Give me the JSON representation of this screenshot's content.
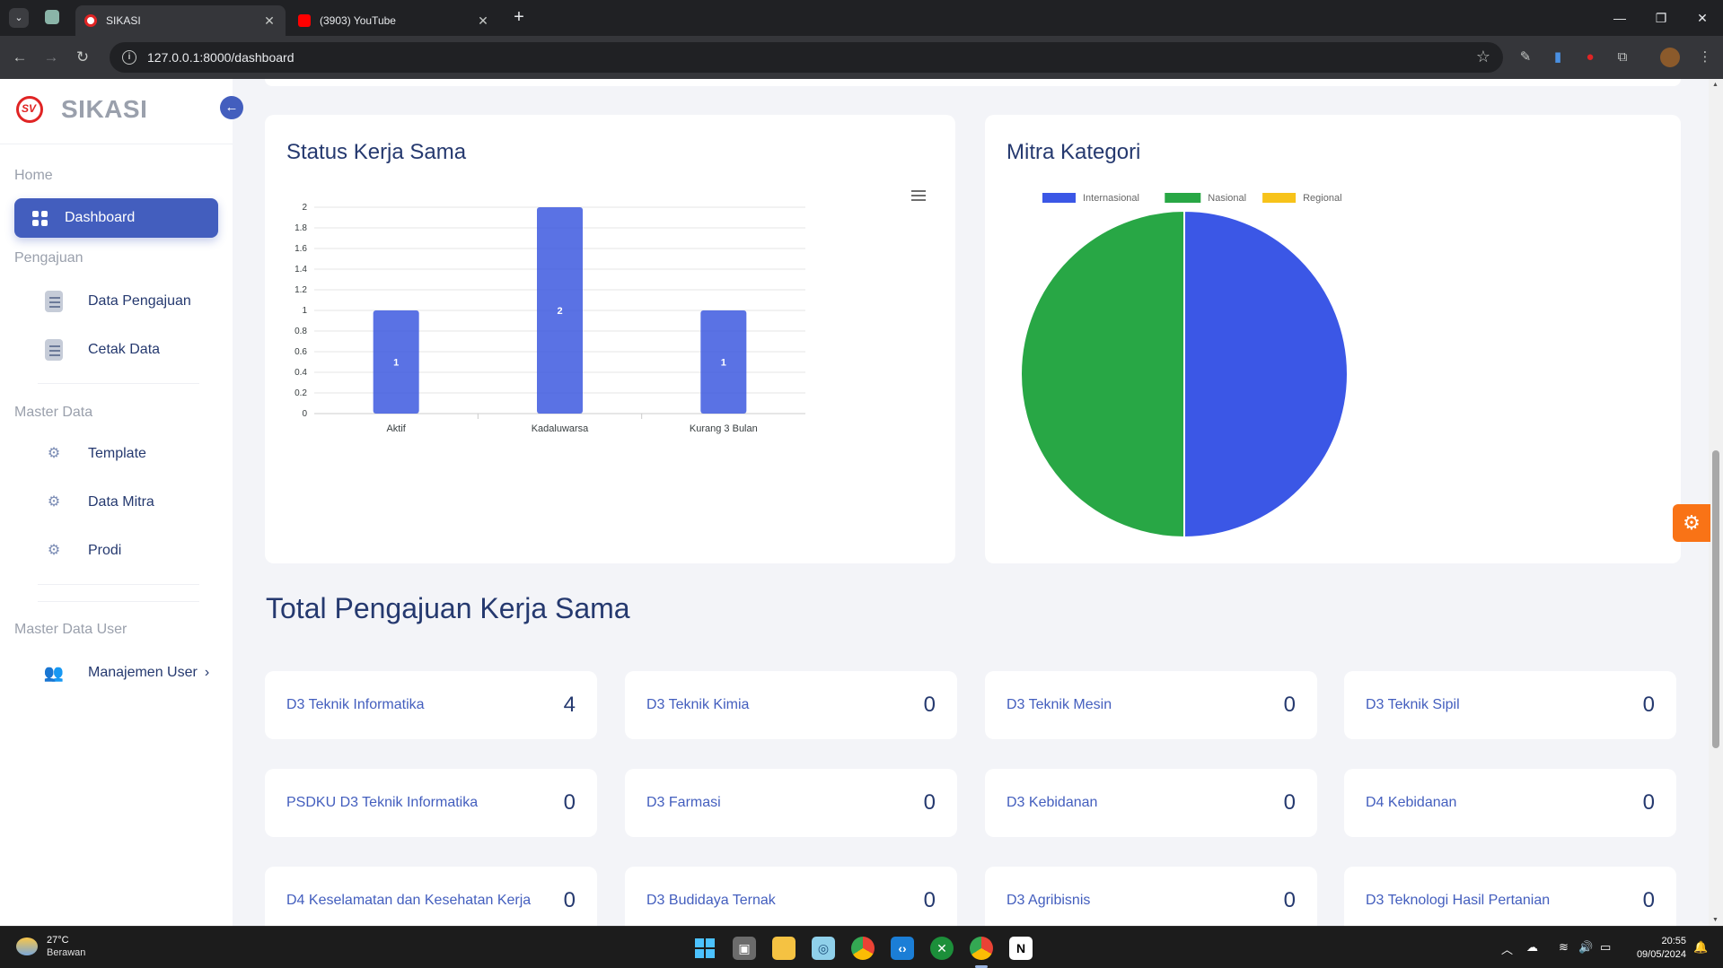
{
  "browser": {
    "tabs": [
      {
        "title": "SIKASI",
        "active": true
      },
      {
        "title": "(3903) YouTube",
        "active": false
      }
    ],
    "url": "127.0.0.1:8000/dashboard"
  },
  "sidebar": {
    "brand": "SIKASI",
    "sections": [
      {
        "title": "Home",
        "items": [
          {
            "label": "Dashboard",
            "icon": "grid-icon",
            "active": true
          }
        ]
      },
      {
        "title": "Pengajuan",
        "items": [
          {
            "label": "Data Pengajuan",
            "icon": "document-icon"
          },
          {
            "label": "Cetak Data",
            "icon": "download-icon"
          }
        ]
      },
      {
        "title": "Master Data",
        "items": [
          {
            "label": "Template",
            "icon": "gear-icon"
          },
          {
            "label": "Data Mitra",
            "icon": "gear-icon"
          },
          {
            "label": "Prodi",
            "icon": "gear-icon"
          }
        ]
      },
      {
        "title": "Master Data User",
        "items": [
          {
            "label": "Manajemen User",
            "icon": "users-icon"
          }
        ]
      }
    ]
  },
  "status_card": {
    "title": "Status Kerja Sama"
  },
  "mitra_card": {
    "title": "Mitra Kategori"
  },
  "chart_data": [
    {
      "type": "bar",
      "title": "Status Kerja Sama",
      "categories": [
        "Aktif",
        "Kadaluwarsa",
        "Kurang 3 Bulan"
      ],
      "values": [
        1,
        2,
        1
      ],
      "ylim": [
        0,
        2
      ],
      "yticks": [
        "0",
        "0.2",
        "0.4",
        "0.6",
        "0.8",
        "1",
        "1.2",
        "1.4",
        "1.6",
        "1.8",
        "2"
      ],
      "color": "#435ee0",
      "grid": true
    },
    {
      "type": "pie",
      "title": "Mitra Kategori",
      "labels": [
        "Internasional",
        "Nasional",
        "Regional"
      ],
      "values": [
        1,
        1,
        0
      ],
      "colors": [
        "#3b57e6",
        "#28a745",
        "#f7c31a"
      ],
      "legend": "top"
    }
  ],
  "total_section": {
    "heading": "Total Pengajuan Kerja Sama",
    "prodi": [
      {
        "name": "D3 Teknik Informatika",
        "count": "4"
      },
      {
        "name": "D3 Teknik Kimia",
        "count": "0"
      },
      {
        "name": "D3 Teknik Mesin",
        "count": "0"
      },
      {
        "name": "D3 Teknik Sipil",
        "count": "0"
      },
      {
        "name": "PSDKU D3 Teknik Informatika",
        "count": "0"
      },
      {
        "name": "D3 Farmasi",
        "count": "0"
      },
      {
        "name": "D3 Kebidanan",
        "count": "0"
      },
      {
        "name": "D4 Kebidanan",
        "count": "0"
      },
      {
        "name": "D4 Keselamatan dan Kesehatan Kerja",
        "count": "0"
      },
      {
        "name": "D3 Budidaya Ternak",
        "count": "0"
      },
      {
        "name": "D3 Agribisnis",
        "count": "0"
      },
      {
        "name": "D3 Teknologi Hasil Pertanian",
        "count": "0"
      }
    ]
  },
  "taskbar": {
    "weather": {
      "temp": "27°C",
      "condition": "Berawan"
    },
    "time": "20:55",
    "date": "09/05/2024"
  }
}
